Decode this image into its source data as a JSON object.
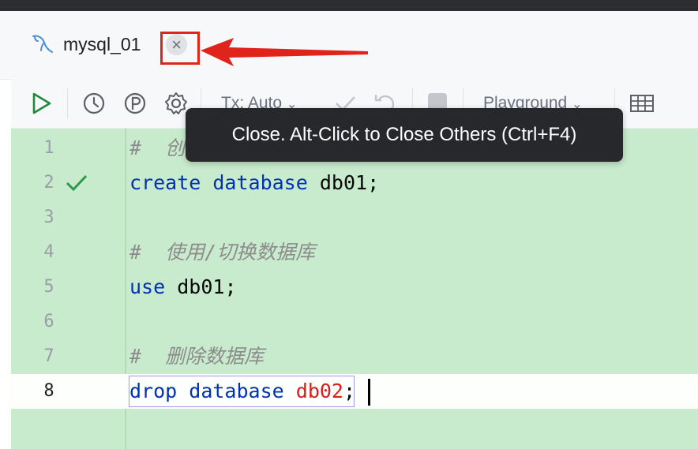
{
  "tab": {
    "label": "mysql_01",
    "close_glyph": "×",
    "icon": "mysql-dolphin-icon"
  },
  "toolbar": {
    "tx_label": "Tx: Auto",
    "playground_label": "Playground",
    "icons": [
      "run-icon",
      "history-icon",
      "parameters-icon",
      "settings-icon",
      "commit-icon",
      "rollback-icon",
      "stop-icon",
      "table-view-icon"
    ]
  },
  "tooltip": {
    "text": "Close. Alt-Click to Close Others (Ctrl+F4)"
  },
  "editor": {
    "lines": [
      {
        "n": "1",
        "hash": "#",
        "comment": "创建"
      },
      {
        "n": "2",
        "kw1": "create",
        "kw2": "database",
        "ident": "db01",
        "end": ";"
      },
      {
        "n": "3"
      },
      {
        "n": "4",
        "hash": "#",
        "comment": "使用/切换数据库"
      },
      {
        "n": "5",
        "kw1": "use",
        "ident": "db01",
        "end": ";"
      },
      {
        "n": "6"
      },
      {
        "n": "7",
        "hash": "#",
        "comment": "删除数据库"
      },
      {
        "n": "8",
        "kw1": "drop",
        "kw2": "database",
        "ident": "db02",
        "end": ";"
      }
    ]
  },
  "colors": {
    "keyword": "#0033b3",
    "comment": "#8c8c8c",
    "error_ident": "#dd1c1c",
    "editor_bg": "#c9ebcd",
    "tab_underline": "#3574f0",
    "annotation_red": "#e1241b",
    "tooltip_bg": "#27282c"
  }
}
